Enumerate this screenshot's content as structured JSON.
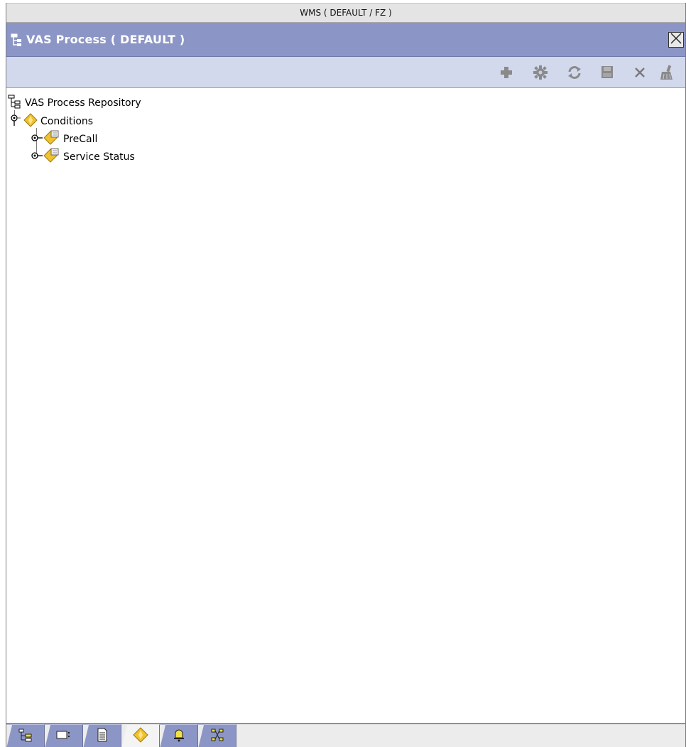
{
  "window": {
    "title": "WMS ( DEFAULT / FZ )"
  },
  "panel": {
    "title": "VAS Process ( DEFAULT )",
    "icon": "hierarchy-icon",
    "close_icon": "close-icon"
  },
  "toolbar": {
    "buttons": [
      {
        "name": "add",
        "icon": "plus-icon"
      },
      {
        "name": "details",
        "icon": "gear-icon"
      },
      {
        "name": "refresh",
        "icon": "refresh-icon"
      },
      {
        "name": "save",
        "icon": "save-icon"
      },
      {
        "name": "delete",
        "icon": "x-icon"
      },
      {
        "name": "cleanup",
        "icon": "broom-icon"
      }
    ]
  },
  "tree": {
    "root": {
      "label": "VAS Process Repository",
      "icon": "hierarchy-icon"
    },
    "group": {
      "label": "Conditions",
      "icon": "diamond-icon",
      "expanded": true
    },
    "children": [
      {
        "label": "PreCall",
        "icon": "condition-icon"
      },
      {
        "label": "Service Status",
        "icon": "condition-icon"
      }
    ]
  },
  "bottom_tabs": [
    {
      "name": "tree-view",
      "icon": "tree-icon",
      "active": false
    },
    {
      "name": "form-view",
      "icon": "form-icon",
      "active": false
    },
    {
      "name": "document-view",
      "icon": "document-icon",
      "active": false
    },
    {
      "name": "conditions-view",
      "icon": "diamond-icon",
      "active": true
    },
    {
      "name": "alerts-view",
      "icon": "bell-icon",
      "active": false
    },
    {
      "name": "network-view",
      "icon": "network-icon",
      "active": false
    }
  ],
  "colors": {
    "header_bg": "#8c96c6",
    "toolbar_bg": "#d3d9ec",
    "diamond": "#f2c12e",
    "toolbar_icon": "#7f7f7f"
  }
}
